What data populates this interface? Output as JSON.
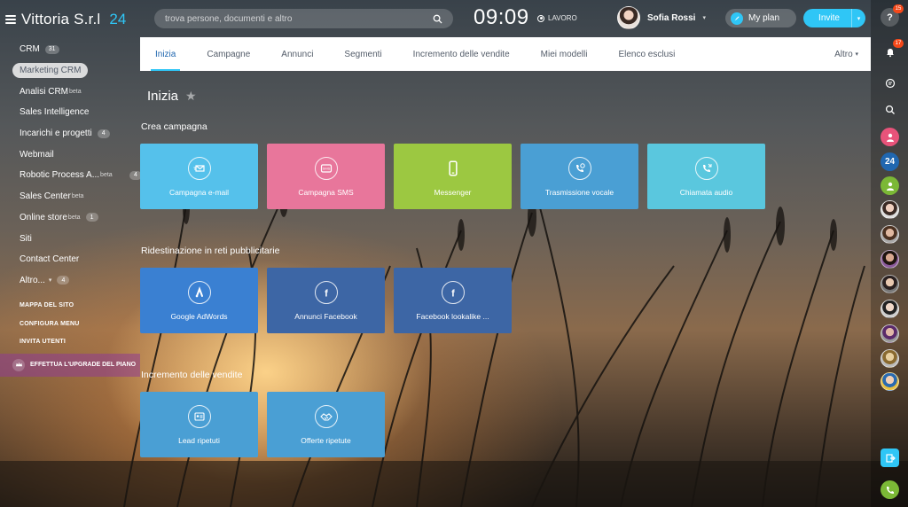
{
  "header": {
    "logo_text": "Vittoria S.r.l",
    "logo_num": "24",
    "search_placeholder": "trova persone, documenti e altro",
    "clock": "09:09",
    "work_status": "LAVORO",
    "user_name": "Sofia Rossi",
    "myplan_label": "My plan",
    "invite_label": "Invite"
  },
  "sidebar": {
    "items": [
      {
        "label": "CRM",
        "count": "31"
      },
      {
        "label": "Marketing CRM",
        "count": ""
      },
      {
        "label": "Analisi CRM",
        "sup": "beta",
        "count": ""
      },
      {
        "label": "Sales Intelligence",
        "count": ""
      },
      {
        "label": "Incarichi e progetti",
        "count": "4"
      },
      {
        "label": "Webmail",
        "count": ""
      },
      {
        "label": "Robotic Process A...",
        "sup": "beta",
        "count": "4"
      },
      {
        "label": "Sales Center",
        "sup": "beta",
        "count": ""
      },
      {
        "label": "Online store",
        "sup": "beta",
        "count": "1"
      },
      {
        "label": "Siti",
        "count": ""
      },
      {
        "label": "Contact Center",
        "count": ""
      },
      {
        "label": "Altro...",
        "count": "4"
      }
    ],
    "system": [
      "MAPPA DEL SITO",
      "CONFIGURA MENU",
      "INVITA UTENTI"
    ],
    "upgrade_label": "EFFETTUA L'UPGRADE DEL PIANO"
  },
  "tabs": [
    "Inizia",
    "Campagne",
    "Annunci",
    "Segmenti",
    "Incremento delle vendite",
    "Miei modelli",
    "Elenco esclusi"
  ],
  "tabs_more": "Altro",
  "page_title": "Inizia",
  "sections": [
    {
      "title": "Crea campagna",
      "tiles": [
        {
          "label": "Campagna e-mail",
          "icon": "email-icon",
          "color": "#55c1eb"
        },
        {
          "label": "Campagna SMS",
          "icon": "sms-icon",
          "color": "#e8769b"
        },
        {
          "label": "Messenger",
          "icon": "phone-icon",
          "color": "#9cc841"
        },
        {
          "label": "Trasmissione vocale",
          "icon": "voice-icon",
          "color": "#4a9fd4"
        },
        {
          "label": "Chiamata audio",
          "icon": "call-icon",
          "color": "#5ac7de"
        }
      ]
    },
    {
      "title": "Ridestinazione in reti pubblicitarie",
      "tiles": [
        {
          "label": "Google AdWords",
          "icon": "adwords-icon",
          "color": "#3a80d2"
        },
        {
          "label": "Annunci Facebook",
          "icon": "facebook-icon",
          "color": "#3d66a5"
        },
        {
          "label": "Facebook lookalike ...",
          "icon": "facebook-icon",
          "color": "#3d66a5"
        }
      ]
    },
    {
      "title": "Incremento delle vendite",
      "tiles": [
        {
          "label": "Lead ripetuti",
          "icon": "lead-icon",
          "color": "#4a9fd4"
        },
        {
          "label": "Offerte ripetute",
          "icon": "handshake-icon",
          "color": "#4a9fd4"
        }
      ]
    }
  ],
  "rail": {
    "help_badge": "15",
    "bell_badge": "17",
    "b24_label": "24"
  }
}
